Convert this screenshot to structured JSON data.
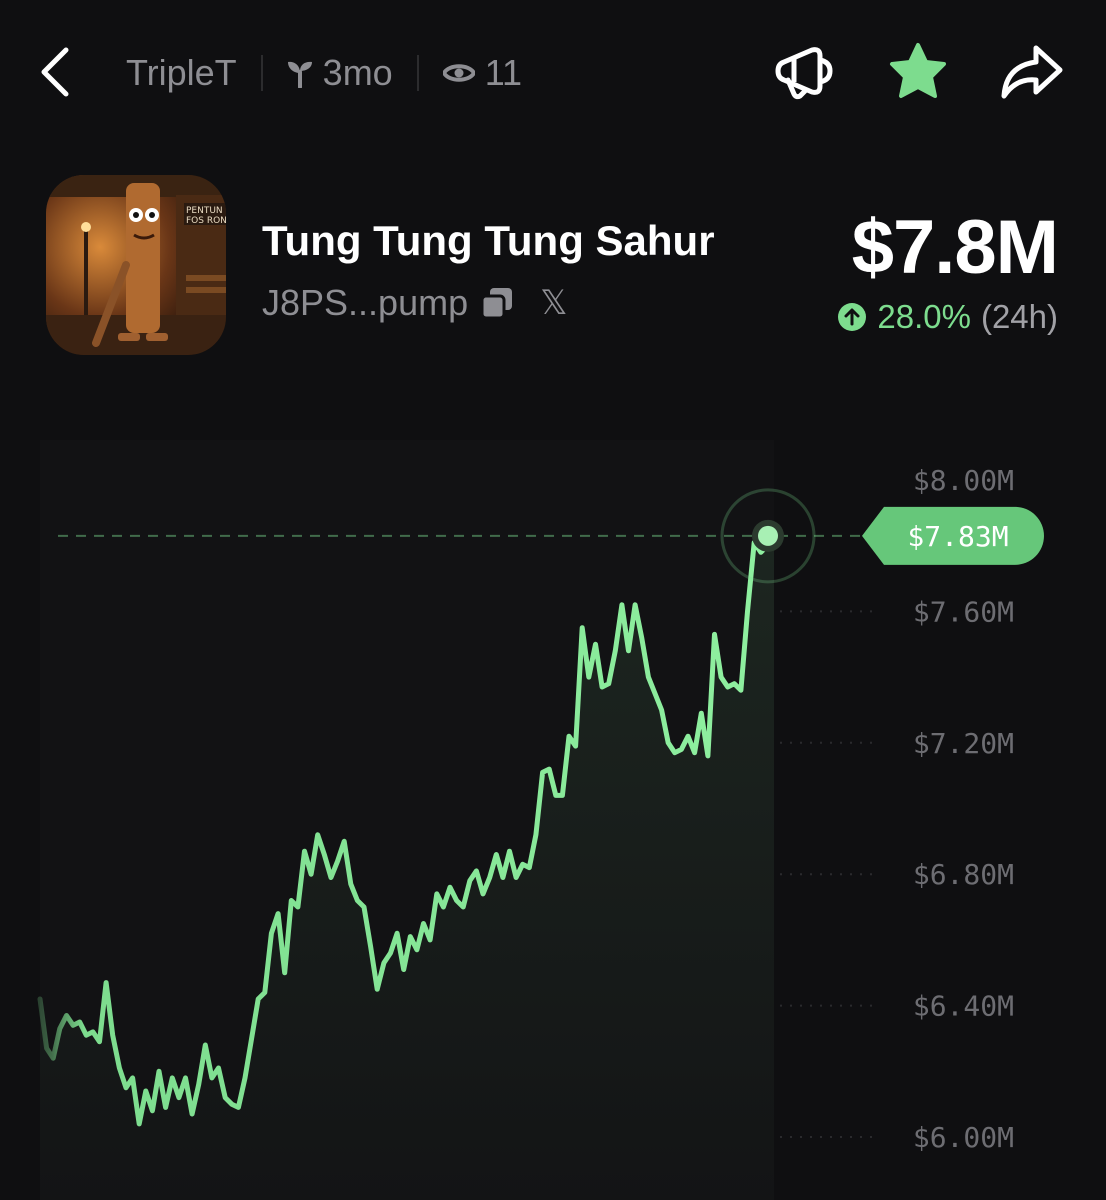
{
  "header": {
    "creator": "TripleT",
    "age": "3mo",
    "views": "11",
    "icons": {
      "back": "chevron-left-icon",
      "age": "sprout-icon",
      "views": "eye-icon",
      "announce": "megaphone-icon",
      "favorite": "star-icon",
      "share": "share-icon"
    }
  },
  "token": {
    "name": "Tung Tung Tung Sahur",
    "address": "J8PS...pump",
    "market_cap": "$7.8M",
    "change_pct": "28.0%",
    "change_period": "(24h)",
    "icons": {
      "copy": "copy-icon",
      "x": "x-icon",
      "change": "arrow-up-circle-icon"
    }
  },
  "colors": {
    "background": "#0f0f11",
    "accent_green": "#7ddc8e",
    "muted": "#8e8e93"
  },
  "chart_data": {
    "type": "line",
    "ylabel_ticks": [
      "$8.00M",
      "$7.60M",
      "$7.20M",
      "$6.80M",
      "$6.40M",
      "$6.00M"
    ],
    "ytick_values": [
      8.0,
      7.6,
      7.2,
      6.8,
      6.4,
      6.0
    ],
    "ylim": [
      6.0,
      8.0
    ],
    "current_label": "$7.83M",
    "current_value": 7.83,
    "unit": "$M",
    "grid": true,
    "series": [
      {
        "values": [
          6.42,
          6.27,
          6.24,
          6.33,
          6.37,
          6.34,
          6.35,
          6.31,
          6.32,
          6.29,
          6.47,
          6.31,
          6.21,
          6.15,
          6.18,
          6.04,
          6.14,
          6.08,
          6.2,
          6.09,
          6.18,
          6.12,
          6.18,
          6.07,
          6.16,
          6.28,
          6.18,
          6.21,
          6.12,
          6.1,
          6.09,
          6.18,
          6.3,
          6.42,
          6.44,
          6.62,
          6.68,
          6.5,
          6.72,
          6.7,
          6.87,
          6.8,
          6.92,
          6.86,
          6.79,
          6.84,
          6.9,
          6.77,
          6.72,
          6.7,
          6.58,
          6.45,
          6.53,
          6.56,
          6.62,
          6.51,
          6.61,
          6.57,
          6.65,
          6.6,
          6.74,
          6.7,
          6.76,
          6.72,
          6.7,
          6.78,
          6.81,
          6.74,
          6.79,
          6.86,
          6.79,
          6.87,
          6.79,
          6.83,
          6.82,
          6.92,
          7.11,
          7.12,
          7.04,
          7.04,
          7.22,
          7.19,
          7.55,
          7.4,
          7.5,
          7.37,
          7.38,
          7.48,
          7.62,
          7.48,
          7.62,
          7.52,
          7.4,
          7.35,
          7.3,
          7.2,
          7.17,
          7.18,
          7.22,
          7.17,
          7.29,
          7.16,
          7.53,
          7.4,
          7.37,
          7.38,
          7.36,
          7.6,
          7.81,
          7.78,
          7.8,
          7.83
        ]
      }
    ]
  }
}
